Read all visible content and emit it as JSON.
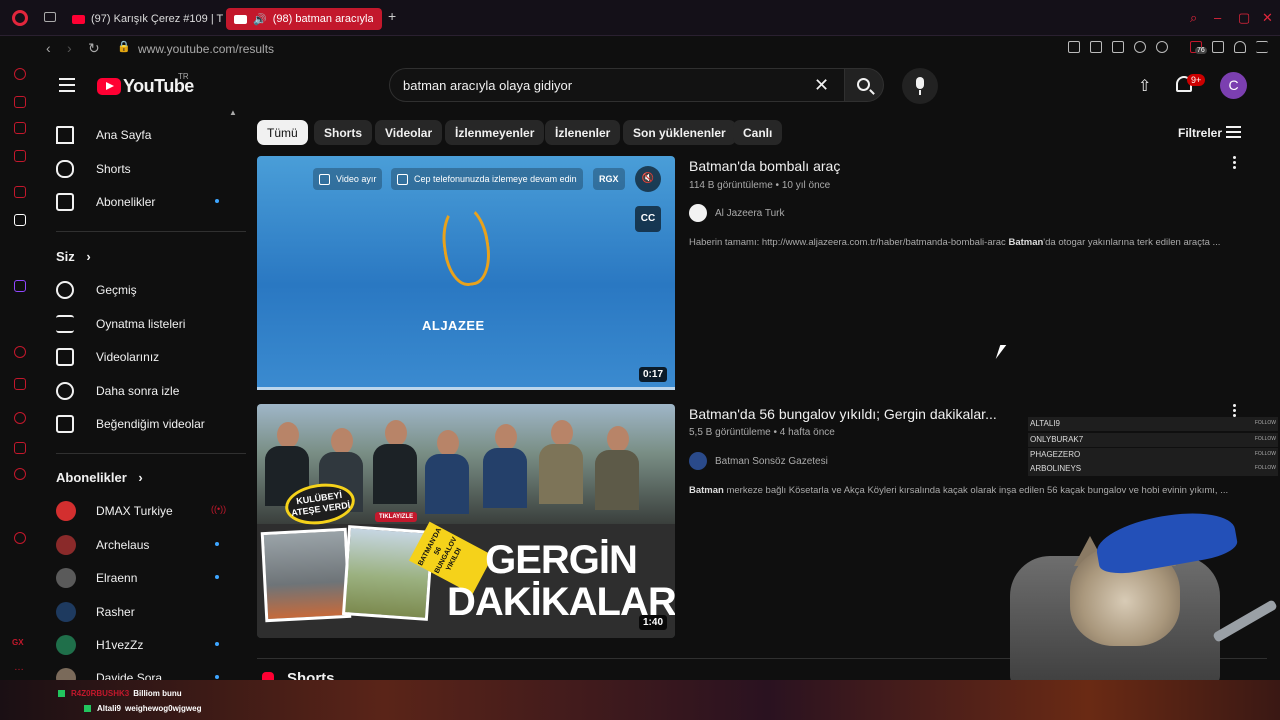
{
  "browser": {
    "tabs": [
      {
        "label": "(97) Karışık Çerez #109 | T",
        "active": false
      },
      {
        "label": "(98) batman aracıyla o",
        "active": true
      }
    ],
    "new_tab": "+",
    "url": "www.youtube.com/results",
    "badge_count": "76"
  },
  "youtube": {
    "logo_text": "YouTube",
    "country": "TR",
    "search_query": "batman aracıyla olaya gidiyor",
    "notification_count": "9+",
    "avatar_letter": "C"
  },
  "sidebar": {
    "main": [
      {
        "label": "Ana Sayfa",
        "icon": "home-icon"
      },
      {
        "label": "Shorts",
        "icon": "shorts-icon"
      },
      {
        "label": "Abonelikler",
        "icon": "subscriptions-icon"
      }
    ],
    "you_header": "Siz",
    "you": [
      {
        "label": "Geçmiş",
        "icon": "history-icon"
      },
      {
        "label": "Oynatma listeleri",
        "icon": "playlist-icon"
      },
      {
        "label": "Videolarınız",
        "icon": "your-videos-icon"
      },
      {
        "label": "Daha sonra izle",
        "icon": "clock-icon"
      },
      {
        "label": "Beğendiğim videolar",
        "icon": "thumbs-up-icon"
      }
    ],
    "subs_header": "Abonelikler",
    "subscriptions": [
      {
        "label": "DMAX Turkiye",
        "color": "#d32f2f",
        "live": true
      },
      {
        "label": "Archelaus",
        "color": "#8a2a2a",
        "live": false
      },
      {
        "label": "Elraenn",
        "color": "#5a5a5a",
        "live": false
      },
      {
        "label": "Rasher",
        "color": "#1e3a5f",
        "live": false
      },
      {
        "label": "H1vezZz",
        "color": "#1f6f4a",
        "live": false
      },
      {
        "label": "Davide Sora",
        "color": "#7a6a5a",
        "live": false
      }
    ]
  },
  "chips": [
    "Tümü",
    "Shorts",
    "Videolar",
    "İzlenmeyenler",
    "İzlenenler",
    "Son yüklenenler",
    "Canlı"
  ],
  "filters_label": "Filtreler",
  "results": [
    {
      "title": "Batman'da bombalı araç",
      "views": "114 B görüntüleme",
      "age": "10 yıl önce",
      "channel": "Al Jazeera Turk",
      "desc_pre": "Haberin tamamı: http://www.aljazeera.com.tr/haber/batmanda-bombali-arac ",
      "desc_bold": "Batman",
      "desc_post": "'da otogar yakınlarına terk edilen araçta ...",
      "duration": "0:17",
      "thumb_text": "ALJAZEE",
      "overlay_detach": "Video ayır",
      "overlay_phone": "Cep telefonunuzda izlemeye devam edin",
      "overlay_tag": "RGX",
      "overlay_cc": "CC"
    },
    {
      "title": "Batman'da 56 bungalov yıkıldı; Gergin dakikalar...",
      "views": "5,5 B görüntüleme",
      "age": "4 hafta önce",
      "channel": "Batman Sonsöz Gazetesi",
      "desc_bold": "Batman",
      "desc_post": " merkeze bağlı Kösetarla ve Akça Köyleri kırsalında kaçak olarak inşa edilen 56 kaçak bungalov ve hobi evinin yıkımı, ...",
      "duration": "1:40",
      "thumb_badge": "KULÜBEYİ ATEŞE VERDİ",
      "thumb_tikla": "TIKLAYIZLE",
      "thumb_tag": "BATMAN'DA 56 BUNGALOV YIKILDI",
      "thumb_line1": "GERGİN",
      "thumb_line2": "DAKİKALAR"
    }
  ],
  "shorts_header": "Shorts",
  "stream": {
    "followers": [
      {
        "name": "ALTALI9",
        "tag": "FOLLOW"
      },
      {
        "name": "ONLYBURAK7",
        "tag": "FOLLOW"
      },
      {
        "name": "PHAGEZERO",
        "tag": "FOLLOW"
      },
      {
        "name": "ARBOLINEYS",
        "tag": "FOLLOW"
      }
    ],
    "chat": [
      {
        "name": "R4Z0RBUSHK3",
        "text": "Billiom bunu"
      },
      {
        "name": "Altali9",
        "text": "weighewog0wjgweg"
      }
    ]
  }
}
